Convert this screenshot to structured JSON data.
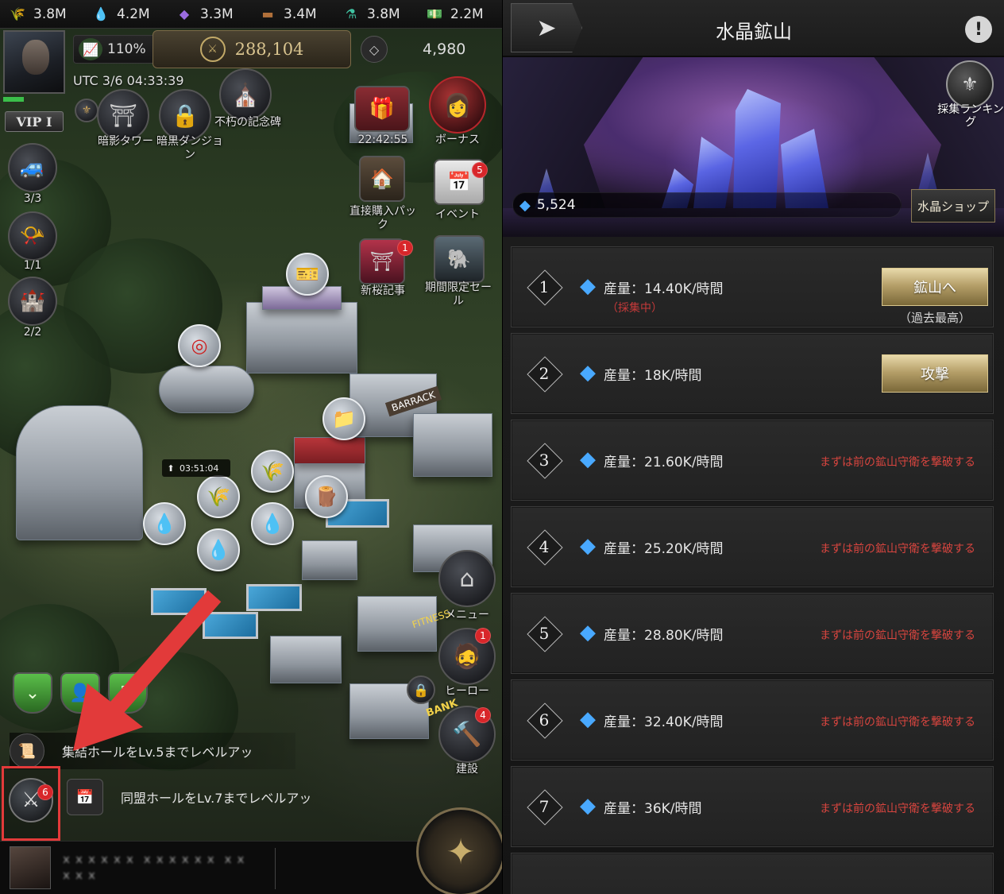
{
  "resources": [
    {
      "icon": "wheat-icon",
      "value": "3.8M"
    },
    {
      "icon": "water-drop-icon",
      "value": "4.2M"
    },
    {
      "icon": "crystal-icon",
      "value": "3.3M"
    },
    {
      "icon": "wood-log-icon",
      "value": "3.4M"
    },
    {
      "icon": "potion-icon",
      "value": "3.8M"
    },
    {
      "icon": "cash-icon",
      "value": "2.2M"
    }
  ],
  "status": {
    "growth_pct": "110%",
    "power": "288,104",
    "diamonds": "4,980",
    "utc": "UTC 3/6 04:33:39",
    "vip": "VIP I"
  },
  "top_icons": {
    "shadow_tower": "暗影タワー",
    "dark_dungeon": "暗黒ダンジョン",
    "immortal_monument": "不朽の記念碑",
    "timer": "22:42:55",
    "bonus": "ボーナス",
    "direct_pack": "直接購入パック",
    "event": "イベント",
    "event_badge": "5",
    "sakura": "新桜記事",
    "sakura_badge": "1",
    "limited": "期間限定セール"
  },
  "side": {
    "vehicle_count": "3/3",
    "horn_count": "1/1",
    "castle_count": "2/2"
  },
  "city": {
    "build_timer": "03:51:04",
    "barrack": "BARRACK",
    "bank": "BANK",
    "fitness": "FITNESS",
    "menu_label": "メニュー",
    "hero_label": "ヒーロー",
    "hero_badge": "1",
    "build_label": "建設",
    "build_badge": "4"
  },
  "tasks": {
    "task1": "集結ホールをLv.5までレベルアッ",
    "task2": "同盟ホールをLv.7までレベルアッ",
    "battle_badge": "6"
  },
  "chat": {
    "blurred": "ｘｘｘｘｘｘ ｘｘｘｘｘｘ ｘｘ ｘｘｘ"
  },
  "mine": {
    "title": "水晶鉱山",
    "crystal_count": "5,524",
    "shop_label": "水晶ショップ",
    "ranking_label": "採集ランキング",
    "rows": [
      {
        "num": "1",
        "prod": "産量：14.40K/時間",
        "sub": "（採集中）",
        "btn": "鉱山へ",
        "note": "（過去最高）",
        "lock": ""
      },
      {
        "num": "2",
        "prod": "産量：18K/時間",
        "sub": "",
        "btn": "攻撃",
        "note": "",
        "lock": ""
      },
      {
        "num": "3",
        "prod": "産量：21.60K/時間",
        "sub": "",
        "btn": "",
        "note": "",
        "lock": "まずは前の鉱山守衛を撃破する"
      },
      {
        "num": "4",
        "prod": "産量：25.20K/時間",
        "sub": "",
        "btn": "",
        "note": "",
        "lock": "まずは前の鉱山守衛を撃破する"
      },
      {
        "num": "5",
        "prod": "産量：28.80K/時間",
        "sub": "",
        "btn": "",
        "note": "",
        "lock": "まずは前の鉱山守衛を撃破する"
      },
      {
        "num": "6",
        "prod": "産量：32.40K/時間",
        "sub": "",
        "btn": "",
        "note": "",
        "lock": "まずは前の鉱山守衛を撃破する"
      },
      {
        "num": "7",
        "prod": "産量：36K/時間",
        "sub": "",
        "btn": "",
        "note": "",
        "lock": "まずは前の鉱山守衛を撃破する"
      }
    ]
  },
  "colors": {
    "accent_gold": "#c2a968",
    "lock_red": "#d8453f",
    "crystal_blue": "#49a9ff",
    "highlight_red": "#e33a3a"
  }
}
